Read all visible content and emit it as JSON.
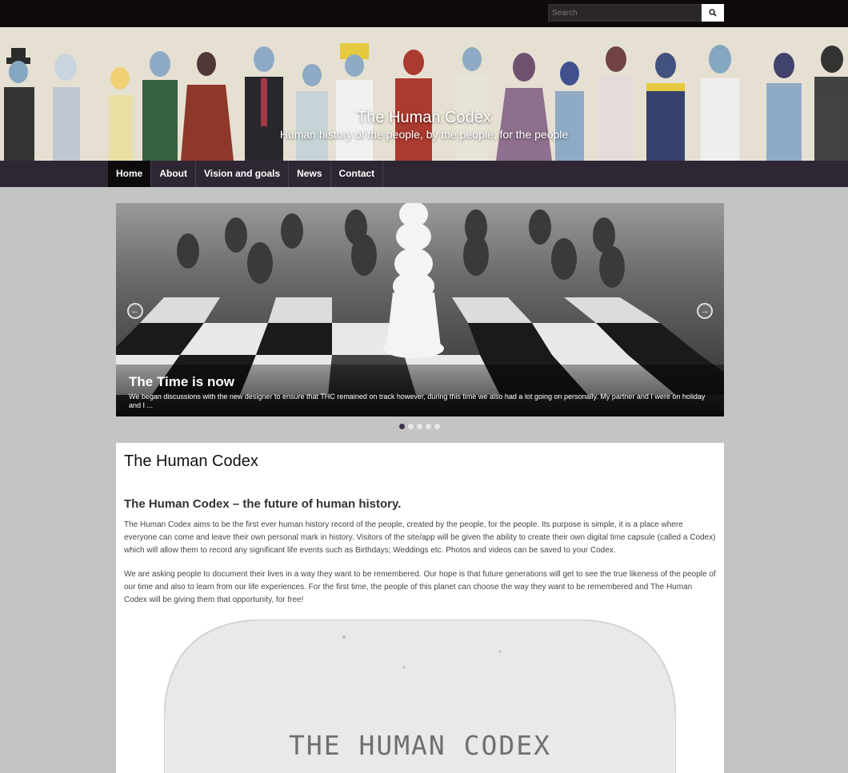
{
  "search": {
    "placeholder": "Search"
  },
  "header": {
    "title": "The Human Codex",
    "tagline": "Human history of the people, by the people, for the people"
  },
  "nav": {
    "items": [
      "Home",
      "About",
      "Vision and goals",
      "News",
      "Contact"
    ],
    "active": "Home"
  },
  "slider": {
    "title": "The Time is now",
    "excerpt": "We began discussions with the new designer to ensure that THC remained on track however, during this time we also had a lot going on personally. My partner and I were on holiday and I ...",
    "slide_count": 5,
    "active_slide": 1
  },
  "content": {
    "page_title": "The Human Codex",
    "subheading": "The Human Codex – the future of human history.",
    "paragraph1": "The Human Codex aims to be the first ever human history record of the people, created by the people, for the people. Its purpose is simple, it is a place where everyone can come and leave their own personal mark in history. Visitors of the site/app will be given the ability to create their own digital time capsule (called a Codex) which will allow them to record any significant life events such as Birthdays; Weddings etc. Photos and videos can be saved to your Codex.",
    "paragraph2": "We are asking people to document their lives in a way they want to be remembered. Our hope is that future generations will get to see the true likeness of the people of our time and also to learn from our life experiences. For the first time, the people of this planet can choose the way they want to be remembered and The Human Codex will be giving them that opportunity, for free!",
    "image_text": "THE HUMAN CODEX"
  },
  "colors": {
    "topbar": "#0f0a0b",
    "nav": "#2e2633",
    "nav_active": "#0d0a0e",
    "page_bg": "#c4c4c4",
    "dot_active": "#3d3247"
  }
}
